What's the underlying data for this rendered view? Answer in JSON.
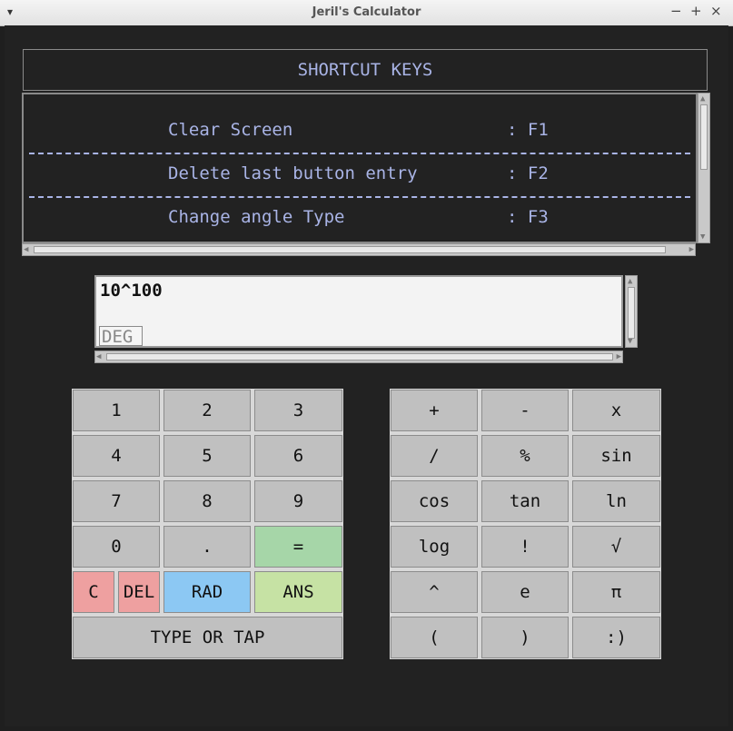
{
  "window": {
    "title": "Jeril's Calculator",
    "menu_glyph": "▾",
    "min_glyph": "−",
    "max_glyph": "+",
    "close_glyph": "×"
  },
  "shortcuts": {
    "heading": "SHORTCUT KEYS",
    "rows": [
      {
        "label": "Clear Screen",
        "key": ": F1"
      },
      {
        "label": "Delete last button entry",
        "key": ": F2"
      },
      {
        "label": "Change angle Type",
        "key": ": F3"
      }
    ]
  },
  "display": {
    "expression": "10^100",
    "angle_mode": "DEG"
  },
  "left_pad": [
    [
      "1",
      "2",
      "3"
    ],
    [
      "4",
      "5",
      "6"
    ],
    [
      "7",
      "8",
      "9"
    ],
    [
      "0",
      ".",
      "="
    ]
  ],
  "left_pad_bottom": {
    "clear": "C",
    "delete": "DEL",
    "rad": "RAD",
    "ans": "ANS",
    "type_or_tap": "TYPE OR TAP"
  },
  "right_pad": [
    [
      "+",
      "-",
      "x"
    ],
    [
      "/",
      "%",
      "sin"
    ],
    [
      "cos",
      "tan",
      "ln"
    ],
    [
      "log",
      "!",
      "√"
    ],
    [
      "^",
      "e",
      "π"
    ],
    [
      "(",
      ")",
      ":)"
    ]
  ],
  "colors": {
    "equals": "#a6d6a8",
    "clear": "#eea0a0",
    "delete": "#eea0a0",
    "rad": "#8cc8f3",
    "ans": "#c6e2a4",
    "shortcut_text": "#a9b4e6"
  }
}
